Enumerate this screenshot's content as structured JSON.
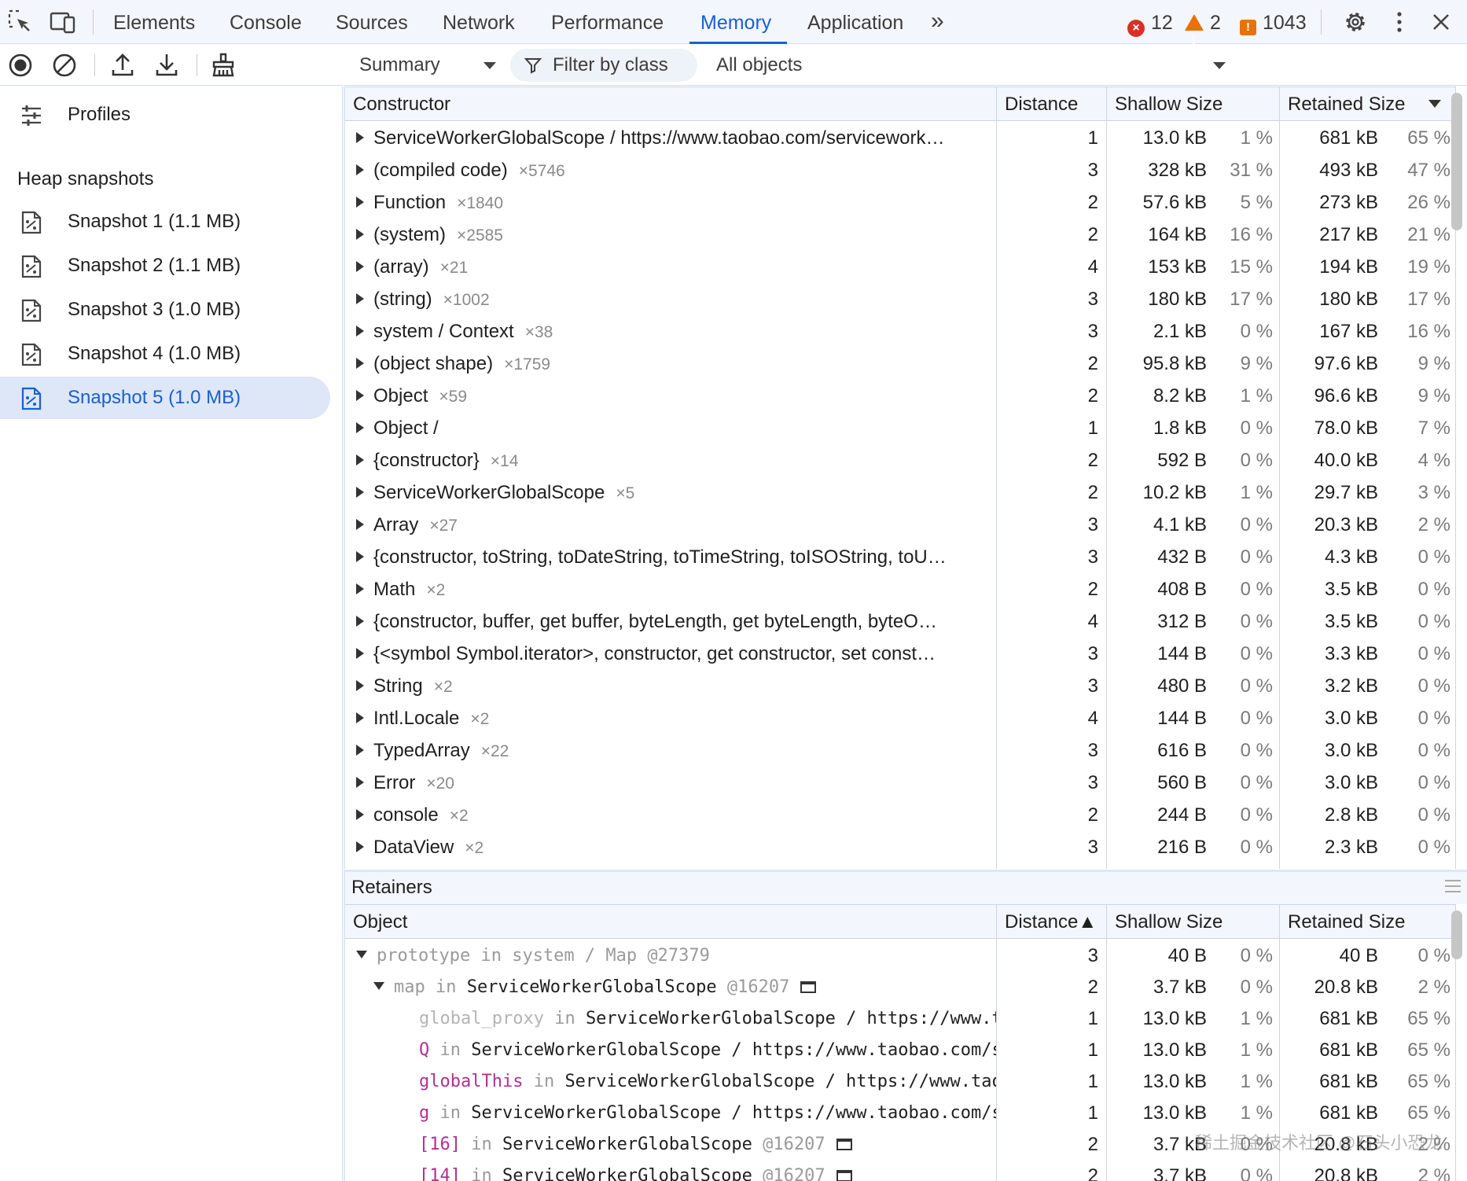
{
  "topbar": {
    "tabs": [
      "Elements",
      "Console",
      "Sources",
      "Network",
      "Performance",
      "Memory",
      "Application"
    ],
    "active_tab": "Memory",
    "more_tabs_glyph": "»",
    "errors_count": "12",
    "warnings_count": "2",
    "issues_count": "1043"
  },
  "sidebar": {
    "profiles_label": "Profiles",
    "section_title": "Heap snapshots",
    "snapshots": [
      "Snapshot 1 (1.1 MB)",
      "Snapshot 2 (1.1 MB)",
      "Snapshot 3 (1.0 MB)",
      "Snapshot 4 (1.0 MB)",
      "Snapshot 5 (1.0 MB)"
    ],
    "selected_snapshot": "Snapshot 5 (1.0 MB)"
  },
  "toolbar": {
    "view_select": "Summary",
    "filter_placeholder": "Filter by class",
    "objects_select": "All objects"
  },
  "constructors_table": {
    "headers": {
      "name": "Constructor",
      "distance": "Distance",
      "shallow": "Shallow Size",
      "retained": "Retained Size"
    },
    "rows": [
      {
        "name": "ServiceWorkerGlobalScope / https://www.taobao.com/servicework…",
        "count": "",
        "distance": "1",
        "shallow": "13.0 kB",
        "shallow_pct": "1 %",
        "retained": "681 kB",
        "retained_pct": "65 %"
      },
      {
        "name": "(compiled code)",
        "count": "×5746",
        "distance": "3",
        "shallow": "328 kB",
        "shallow_pct": "31 %",
        "retained": "493 kB",
        "retained_pct": "47 %"
      },
      {
        "name": "Function",
        "count": "×1840",
        "distance": "2",
        "shallow": "57.6 kB",
        "shallow_pct": "5 %",
        "retained": "273 kB",
        "retained_pct": "26 %"
      },
      {
        "name": "(system)",
        "count": "×2585",
        "distance": "2",
        "shallow": "164 kB",
        "shallow_pct": "16 %",
        "retained": "217 kB",
        "retained_pct": "21 %"
      },
      {
        "name": "(array)",
        "count": "×21",
        "distance": "4",
        "shallow": "153 kB",
        "shallow_pct": "15 %",
        "retained": "194 kB",
        "retained_pct": "19 %"
      },
      {
        "name": "(string)",
        "count": "×1002",
        "distance": "3",
        "shallow": "180 kB",
        "shallow_pct": "17 %",
        "retained": "180 kB",
        "retained_pct": "17 %"
      },
      {
        "name": "system / Context",
        "count": "×38",
        "distance": "3",
        "shallow": "2.1 kB",
        "shallow_pct": "0 %",
        "retained": "167 kB",
        "retained_pct": "16 %"
      },
      {
        "name": "(object shape)",
        "count": "×1759",
        "distance": "2",
        "shallow": "95.8 kB",
        "shallow_pct": "9 %",
        "retained": "97.6 kB",
        "retained_pct": "9 %"
      },
      {
        "name": "Object",
        "count": "×59",
        "distance": "2",
        "shallow": "8.2 kB",
        "shallow_pct": "1 %",
        "retained": "96.6 kB",
        "retained_pct": "9 %"
      },
      {
        "name": "Object /",
        "count": "",
        "distance": "1",
        "shallow": "1.8 kB",
        "shallow_pct": "0 %",
        "retained": "78.0 kB",
        "retained_pct": "7 %"
      },
      {
        "name": "{constructor}",
        "count": "×14",
        "distance": "2",
        "shallow": "592 B",
        "shallow_pct": "0 %",
        "retained": "40.0 kB",
        "retained_pct": "4 %"
      },
      {
        "name": "ServiceWorkerGlobalScope",
        "count": "×5",
        "distance": "2",
        "shallow": "10.2 kB",
        "shallow_pct": "1 %",
        "retained": "29.7 kB",
        "retained_pct": "3 %"
      },
      {
        "name": "Array",
        "count": "×27",
        "distance": "3",
        "shallow": "4.1 kB",
        "shallow_pct": "0 %",
        "retained": "20.3 kB",
        "retained_pct": "2 %"
      },
      {
        "name": "{constructor, toString, toDateString, toTimeString, toISOString, toU…",
        "count": "",
        "distance": "3",
        "shallow": "432 B",
        "shallow_pct": "0 %",
        "retained": "4.3 kB",
        "retained_pct": "0 %"
      },
      {
        "name": "Math",
        "count": "×2",
        "distance": "2",
        "shallow": "408 B",
        "shallow_pct": "0 %",
        "retained": "3.5 kB",
        "retained_pct": "0 %"
      },
      {
        "name": "{constructor, buffer, get buffer, byteLength, get byteLength, byteO…",
        "count": "",
        "distance": "4",
        "shallow": "312 B",
        "shallow_pct": "0 %",
        "retained": "3.5 kB",
        "retained_pct": "0 %"
      },
      {
        "name": "{<symbol Symbol.iterator>, constructor, get constructor, set const…",
        "count": "",
        "distance": "3",
        "shallow": "144 B",
        "shallow_pct": "0 %",
        "retained": "3.3 kB",
        "retained_pct": "0 %"
      },
      {
        "name": "String",
        "count": "×2",
        "distance": "3",
        "shallow": "480 B",
        "shallow_pct": "0 %",
        "retained": "3.2 kB",
        "retained_pct": "0 %"
      },
      {
        "name": "Intl.Locale",
        "count": "×2",
        "distance": "4",
        "shallow": "144 B",
        "shallow_pct": "0 %",
        "retained": "3.0 kB",
        "retained_pct": "0 %"
      },
      {
        "name": "TypedArray",
        "count": "×22",
        "distance": "3",
        "shallow": "616 B",
        "shallow_pct": "0 %",
        "retained": "3.0 kB",
        "retained_pct": "0 %"
      },
      {
        "name": "Error",
        "count": "×20",
        "distance": "3",
        "shallow": "560 B",
        "shallow_pct": "0 %",
        "retained": "3.0 kB",
        "retained_pct": "0 %"
      },
      {
        "name": "console",
        "count": "×2",
        "distance": "2",
        "shallow": "244 B",
        "shallow_pct": "0 %",
        "retained": "2.8 kB",
        "retained_pct": "0 %"
      },
      {
        "name": "DataView",
        "count": "×2",
        "distance": "3",
        "shallow": "216 B",
        "shallow_pct": "0 %",
        "retained": "2.3 kB",
        "retained_pct": "0 %"
      }
    ]
  },
  "retainers": {
    "title": "Retainers",
    "headers": {
      "name": "Object",
      "distance": "Distance▲",
      "shallow": "Shallow Size",
      "retained": "Retained Size"
    },
    "rows": [
      {
        "prefix": "prototype",
        "mid": " in ",
        "owner": "system / Map",
        "suffix": " @27379",
        "distance": "3",
        "shallow": "40 B",
        "shallow_pct": "0 %",
        "retained": "40 B",
        "retained_pct": "0 %"
      },
      {
        "prefix": "map",
        "mid": " in ",
        "owner": "ServiceWorkerGlobalScope",
        "suffix": " @16207",
        "distance": "2",
        "shallow": "3.7 kB",
        "shallow_pct": "0 %",
        "retained": "20.8 kB",
        "retained_pct": "2 %"
      },
      {
        "prefix": "global_proxy",
        "mid": " in ",
        "owner": "ServiceWorkerGlobalScope / https://www.taobao.com/s",
        "suffix": "",
        "distance": "1",
        "shallow": "13.0 kB",
        "shallow_pct": "1 %",
        "retained": "681 kB",
        "retained_pct": "65 %"
      },
      {
        "prefix": "Q",
        "mid": " in ",
        "owner": "ServiceWorkerGlobalScope / https://www.taobao.com/s",
        "suffix": "",
        "distance": "1",
        "shallow": "13.0 kB",
        "shallow_pct": "1 %",
        "retained": "681 kB",
        "retained_pct": "65 %"
      },
      {
        "prefix": "globalThis",
        "mid": " in ",
        "owner": "ServiceWorkerGlobalScope / https://www.taobao.com/s",
        "suffix": "",
        "distance": "1",
        "shallow": "13.0 kB",
        "shallow_pct": "1 %",
        "retained": "681 kB",
        "retained_pct": "65 %"
      },
      {
        "prefix": "g",
        "mid": " in ",
        "owner": "ServiceWorkerGlobalScope / https://www.taobao.com/s",
        "suffix": "",
        "distance": "1",
        "shallow": "13.0 kB",
        "shallow_pct": "1 %",
        "retained": "681 kB",
        "retained_pct": "65 %"
      },
      {
        "prefix": "[16]",
        "mid": " in ",
        "owner": "ServiceWorkerGlobalScope",
        "suffix": " @16207",
        "distance": "2",
        "shallow": "3.7 kB",
        "shallow_pct": "0 %",
        "retained": "20.8 kB",
        "retained_pct": "2 %"
      },
      {
        "prefix": "[14]",
        "mid": " in ",
        "owner": "ServiceWorkerGlobalScope",
        "suffix": " @16207",
        "distance": "2",
        "shallow": "3.7 kB",
        "shallow_pct": "0 %",
        "retained": "20.8 kB",
        "retained_pct": "2 %"
      }
    ]
  },
  "watermark": "稀土掘金技术社区 @石头小恐龙",
  "colors": {
    "accent": "#1a5fd1",
    "error": "#d93025",
    "warning": "#e8710a",
    "selected_bg": "#dde7f8"
  }
}
